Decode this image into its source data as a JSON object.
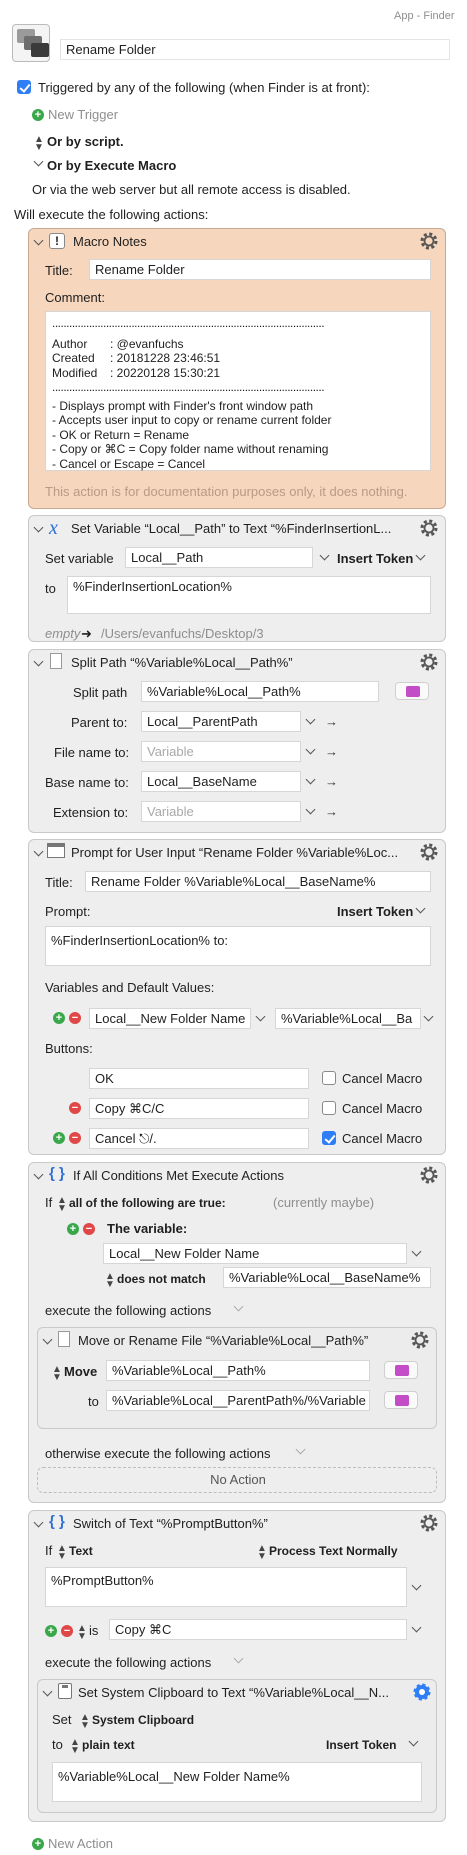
{
  "header": {
    "app_label": "App - Finder",
    "macro_name": "Rename Folder"
  },
  "triggers": {
    "triggered_label": "Triggered by any of the following (when Finder is at front):",
    "new_trigger": "New Trigger",
    "or_by_script": "Or by script.",
    "or_by_execute_macro": "Or by Execute Macro",
    "web_server_note": "Or via the web server but all remote access is disabled."
  },
  "will_execute": "Will execute the following actions:",
  "notes": {
    "title": "Macro Notes",
    "title_label": "Title:",
    "title_value": "Rename Folder",
    "comment_label": "Comment:",
    "rule": "................................................................................................",
    "meta": [
      {
        "k": "Author",
        "v": ": @evanfuchs"
      },
      {
        "k": "Created",
        "v": ": 20181228 23:46:51"
      },
      {
        "k": "Modified",
        "v": ": 20220128 15:30:21"
      }
    ],
    "bullets": [
      "- Displays prompt with Finder's front window path",
      "- Accepts user input to copy or rename current folder",
      "- OK or Return = Rename",
      "- Copy or ⌘C = Copy folder name without renaming",
      "- Cancel or Escape = Cancel"
    ],
    "footer": "This action is for documentation purposes only, it does nothing."
  },
  "setvar": {
    "title": "Set Variable “Local__Path” to Text “%FinderInsertionL...",
    "set_variable_label": "Set variable",
    "variable": "Local__Path",
    "insert_token": "Insert Token",
    "to_label": "to",
    "to_value": "%FinderInsertionLocation%",
    "preview_empty": "empty",
    "preview_path": "/Users/evanfuchs/Desktop/3"
  },
  "splitpath": {
    "title": "Split Path “%Variable%Local__Path%”",
    "split_path_label": "Split path",
    "split_path_value": "%Variable%Local__Path%",
    "rows": [
      {
        "label": "Parent to:",
        "value": "Local__ParentPath",
        "placeholder": false
      },
      {
        "label": "File name to:",
        "value": "Variable",
        "placeholder": true
      },
      {
        "label": "Base name to:",
        "value": "Local__BaseName",
        "placeholder": false
      },
      {
        "label": "Extension to:",
        "value": "Variable",
        "placeholder": true
      }
    ]
  },
  "prompt": {
    "title": "Prompt for User Input “Rename Folder %Variable%Loc...",
    "title_label": "Title:",
    "title_value": "Rename Folder %Variable%Local__BaseName%",
    "prompt_label": "Prompt:",
    "insert_token": "Insert Token",
    "prompt_value": "%FinderInsertionLocation% to:",
    "vars_label": "Variables and Default Values:",
    "var_name": "Local__New Folder Name",
    "var_default": "%Variable%Local__Ba",
    "buttons_label": "Buttons:",
    "buttons": [
      {
        "label": "OK",
        "cancel": "Cancel Macro",
        "checked": false
      },
      {
        "label": "Copy ⌘C/C",
        "cancel": "Cancel Macro",
        "checked": false
      },
      {
        "label": "Cancel ⎋/.",
        "cancel": "Cancel Macro",
        "checked": true
      }
    ]
  },
  "ifcond": {
    "title": "If All Conditions Met Execute Actions",
    "if_label": "If",
    "all_true": "all of the following are true:",
    "currently": "(currently maybe)",
    "the_variable": "The variable:",
    "variable_value": "Local__New Folder Name",
    "does_not_match": "does not match",
    "match_value": "%Variable%Local__BaseName%",
    "execute_label": "execute the following actions",
    "otherwise_label": "otherwise execute the following actions",
    "no_action": "No Action"
  },
  "moverename": {
    "title": "Move or Rename File “%Variable%Local__Path%”",
    "mode": "Move",
    "from_value": "%Variable%Local__Path%",
    "to_label": "to",
    "to_value": "%Variable%Local__ParentPath%/%Variable"
  },
  "switch": {
    "title": "Switch of Text “%PromptButton%”",
    "if_label": "If",
    "text_label": "Text",
    "process_label": "Process Text Normally",
    "text_value": "%PromptButton%",
    "is_label": "is",
    "is_value": "Copy ⌘C",
    "execute_label": "execute the following actions"
  },
  "clipboard": {
    "title": "Set System Clipboard to Text “%Variable%Local__N...",
    "set_label": "Set",
    "clipboard_label": "System Clipboard",
    "to_label": "to",
    "plain_text": "plain text",
    "insert_token": "Insert Token",
    "value": "%Variable%Local__New Folder Name%"
  },
  "new_action": "New Action",
  "colors": {
    "notes_bg": "#f6d6bd",
    "card_bg": "#eeeeee",
    "accent_blue": "#2f7ef6",
    "plus_green": "#3aa84a",
    "minus_red": "#e04848",
    "folder_purple": "#c24dc7"
  }
}
